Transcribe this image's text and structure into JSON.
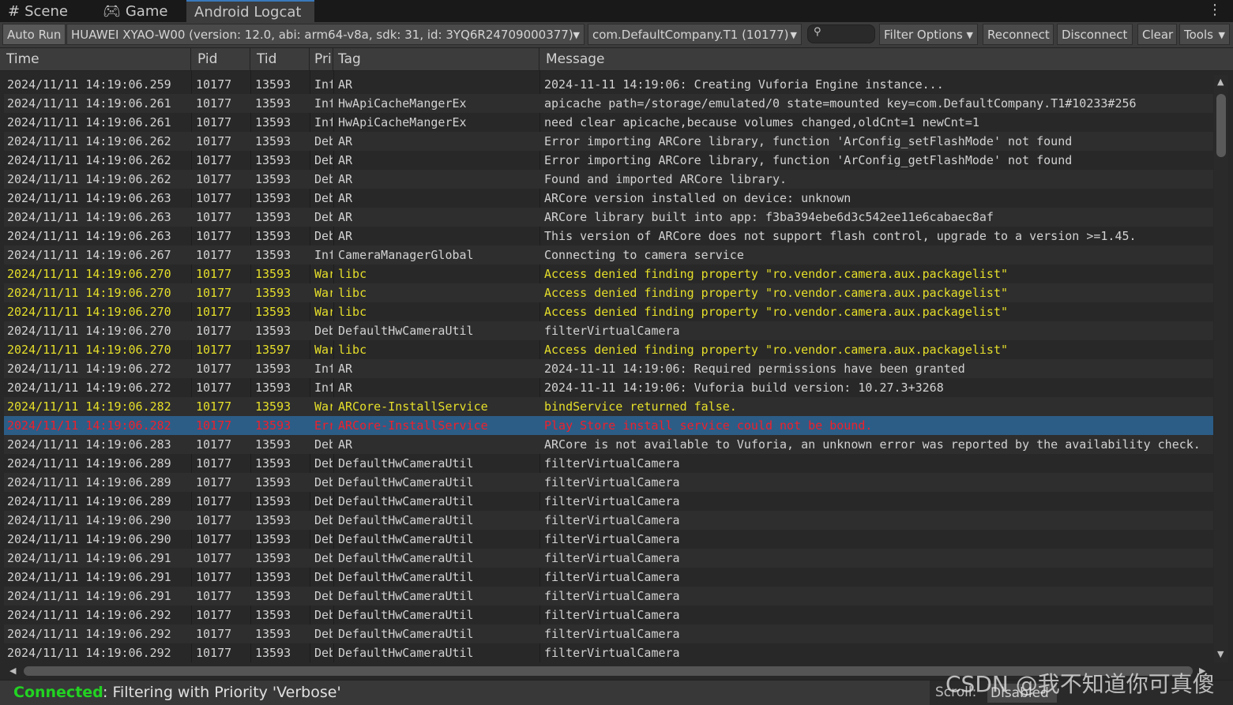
{
  "tabs": [
    {
      "label": "Scene",
      "icon": "grid-icon"
    },
    {
      "label": "Game",
      "icon": "gamepad-icon"
    },
    {
      "label": "Android Logcat",
      "icon": ""
    }
  ],
  "toolbar": {
    "auto_run": "Auto Run",
    "device": "HUAWEI XYAO-W00 (version: 12.0, abi: arm64-v8a, sdk: 31, id: 3YQ6R24709000377)",
    "package": "com.DefaultCompany.T1 (10177)",
    "search_value": "",
    "filter_options": "Filter Options",
    "reconnect": "Reconnect",
    "disconnect": "Disconnect",
    "clear": "Clear",
    "tools": "Tools"
  },
  "columns": [
    "Time",
    "Pid",
    "Tid",
    "Pri",
    "Tag",
    "Message"
  ],
  "colors": {
    "info": "#d2d2d2",
    "warn": "#e6df2a",
    "error": "#f0202a",
    "selected_bg": "#2c5d87",
    "connected": "#22d322"
  },
  "rows": [
    {
      "time": "2024/11/11 14:19:06.259",
      "pid": "10177",
      "tid": "13593",
      "pri": "Info",
      "tag": "AR",
      "msg": "2024-11-11 14:19:06: Creating Vuforia Engine instance...",
      "level": "info"
    },
    {
      "time": "2024/11/11 14:19:06.261",
      "pid": "10177",
      "tid": "13593",
      "pri": "Info",
      "tag": "HwApiCacheMangerEx",
      "msg": "apicache path=/storage/emulated/0 state=mounted key=com.DefaultCompany.T1#10233#256",
      "level": "info"
    },
    {
      "time": "2024/11/11 14:19:06.261",
      "pid": "10177",
      "tid": "13593",
      "pri": "Info",
      "tag": "HwApiCacheMangerEx",
      "msg": "need clear apicache,because volumes changed,oldCnt=1 newCnt=1",
      "level": "info"
    },
    {
      "time": "2024/11/11 14:19:06.262",
      "pid": "10177",
      "tid": "13593",
      "pri": "Debug",
      "tag": "AR",
      "msg": "Error importing ARCore library, function 'ArConfig_setFlashMode' not found",
      "level": "info"
    },
    {
      "time": "2024/11/11 14:19:06.262",
      "pid": "10177",
      "tid": "13593",
      "pri": "Debug",
      "tag": "AR",
      "msg": "Error importing ARCore library, function 'ArConfig_getFlashMode' not found",
      "level": "info"
    },
    {
      "time": "2024/11/11 14:19:06.262",
      "pid": "10177",
      "tid": "13593",
      "pri": "Debug",
      "tag": "AR",
      "msg": "Found and imported ARCore library.",
      "level": "info"
    },
    {
      "time": "2024/11/11 14:19:06.263",
      "pid": "10177",
      "tid": "13593",
      "pri": "Debug",
      "tag": "AR",
      "msg": "ARCore version installed on device: unknown",
      "level": "info"
    },
    {
      "time": "2024/11/11 14:19:06.263",
      "pid": "10177",
      "tid": "13593",
      "pri": "Debug",
      "tag": "AR",
      "msg": "ARCore library built into app: f3ba394ebe6d3c542ee11e6cabaec8af",
      "level": "info"
    },
    {
      "time": "2024/11/11 14:19:06.263",
      "pid": "10177",
      "tid": "13593",
      "pri": "Debug",
      "tag": "AR",
      "msg": "This version of ARCore does not support flash control, upgrade to a version >=1.45.",
      "level": "info"
    },
    {
      "time": "2024/11/11 14:19:06.267",
      "pid": "10177",
      "tid": "13593",
      "pri": "Info",
      "tag": "CameraManagerGlobal",
      "msg": "Connecting to camera service",
      "level": "info"
    },
    {
      "time": "2024/11/11 14:19:06.270",
      "pid": "10177",
      "tid": "13593",
      "pri": "Warn",
      "tag": "libc",
      "msg": "Access denied finding property \"ro.vendor.camera.aux.packagelist\"",
      "level": "warn"
    },
    {
      "time": "2024/11/11 14:19:06.270",
      "pid": "10177",
      "tid": "13593",
      "pri": "Warn",
      "tag": "libc",
      "msg": "Access denied finding property \"ro.vendor.camera.aux.packagelist\"",
      "level": "warn"
    },
    {
      "time": "2024/11/11 14:19:06.270",
      "pid": "10177",
      "tid": "13593",
      "pri": "Warn",
      "tag": "libc",
      "msg": "Access denied finding property \"ro.vendor.camera.aux.packagelist\"",
      "level": "warn"
    },
    {
      "time": "2024/11/11 14:19:06.270",
      "pid": "10177",
      "tid": "13593",
      "pri": "Debug",
      "tag": "DefaultHwCameraUtil",
      "msg": "filterVirtualCamera",
      "level": "info"
    },
    {
      "time": "2024/11/11 14:19:06.270",
      "pid": "10177",
      "tid": "13597",
      "pri": "Warn",
      "tag": "libc",
      "msg": "Access denied finding property \"ro.vendor.camera.aux.packagelist\"",
      "level": "warn"
    },
    {
      "time": "2024/11/11 14:19:06.272",
      "pid": "10177",
      "tid": "13593",
      "pri": "Info",
      "tag": "AR",
      "msg": "2024-11-11 14:19:06: Required permissions have been granted",
      "level": "info"
    },
    {
      "time": "2024/11/11 14:19:06.272",
      "pid": "10177",
      "tid": "13593",
      "pri": "Info",
      "tag": "AR",
      "msg": "2024-11-11 14:19:06: Vuforia build version: 10.27.3+3268",
      "level": "info"
    },
    {
      "time": "2024/11/11 14:19:06.282",
      "pid": "10177",
      "tid": "13593",
      "pri": "Warn",
      "tag": "ARCore-InstallService",
      "msg": "bindService returned false.",
      "level": "warn"
    },
    {
      "time": "2024/11/11 14:19:06.282",
      "pid": "10177",
      "tid": "13593",
      "pri": "Error",
      "tag": "ARCore-InstallService",
      "msg": "Play Store install service could not be bound.",
      "level": "error",
      "selected": true
    },
    {
      "time": "2024/11/11 14:19:06.283",
      "pid": "10177",
      "tid": "13593",
      "pri": "Debug",
      "tag": "AR",
      "msg": "ARCore is not available to Vuforia, an unknown error was reported by the availability check.",
      "level": "info"
    },
    {
      "time": "2024/11/11 14:19:06.289",
      "pid": "10177",
      "tid": "13593",
      "pri": "Debug",
      "tag": "DefaultHwCameraUtil",
      "msg": "filterVirtualCamera",
      "level": "info"
    },
    {
      "time": "2024/11/11 14:19:06.289",
      "pid": "10177",
      "tid": "13593",
      "pri": "Debug",
      "tag": "DefaultHwCameraUtil",
      "msg": "filterVirtualCamera",
      "level": "info"
    },
    {
      "time": "2024/11/11 14:19:06.289",
      "pid": "10177",
      "tid": "13593",
      "pri": "Debug",
      "tag": "DefaultHwCameraUtil",
      "msg": "filterVirtualCamera",
      "level": "info"
    },
    {
      "time": "2024/11/11 14:19:06.290",
      "pid": "10177",
      "tid": "13593",
      "pri": "Debug",
      "tag": "DefaultHwCameraUtil",
      "msg": "filterVirtualCamera",
      "level": "info"
    },
    {
      "time": "2024/11/11 14:19:06.290",
      "pid": "10177",
      "tid": "13593",
      "pri": "Debug",
      "tag": "DefaultHwCameraUtil",
      "msg": "filterVirtualCamera",
      "level": "info"
    },
    {
      "time": "2024/11/11 14:19:06.291",
      "pid": "10177",
      "tid": "13593",
      "pri": "Debug",
      "tag": "DefaultHwCameraUtil",
      "msg": "filterVirtualCamera",
      "level": "info"
    },
    {
      "time": "2024/11/11 14:19:06.291",
      "pid": "10177",
      "tid": "13593",
      "pri": "Debug",
      "tag": "DefaultHwCameraUtil",
      "msg": "filterVirtualCamera",
      "level": "info"
    },
    {
      "time": "2024/11/11 14:19:06.291",
      "pid": "10177",
      "tid": "13593",
      "pri": "Debug",
      "tag": "DefaultHwCameraUtil",
      "msg": "filterVirtualCamera",
      "level": "info"
    },
    {
      "time": "2024/11/11 14:19:06.292",
      "pid": "10177",
      "tid": "13593",
      "pri": "Debug",
      "tag": "DefaultHwCameraUtil",
      "msg": "filterVirtualCamera",
      "level": "info"
    },
    {
      "time": "2024/11/11 14:19:06.292",
      "pid": "10177",
      "tid": "13593",
      "pri": "Debug",
      "tag": "DefaultHwCameraUtil",
      "msg": "filterVirtualCamera",
      "level": "info"
    },
    {
      "time": "2024/11/11 14:19:06.292",
      "pid": "10177",
      "tid": "13593",
      "pri": "Debug",
      "tag": "DefaultHwCameraUtil",
      "msg": "filterVirtualCamera",
      "level": "info"
    }
  ],
  "status": {
    "connected": "Connected",
    "message": ": Filtering with Priority 'Verbose'",
    "scroll_label": "Scroll:",
    "scroll_value": "Disabled"
  },
  "watermark": "CSDN @我不知道你可真傻"
}
